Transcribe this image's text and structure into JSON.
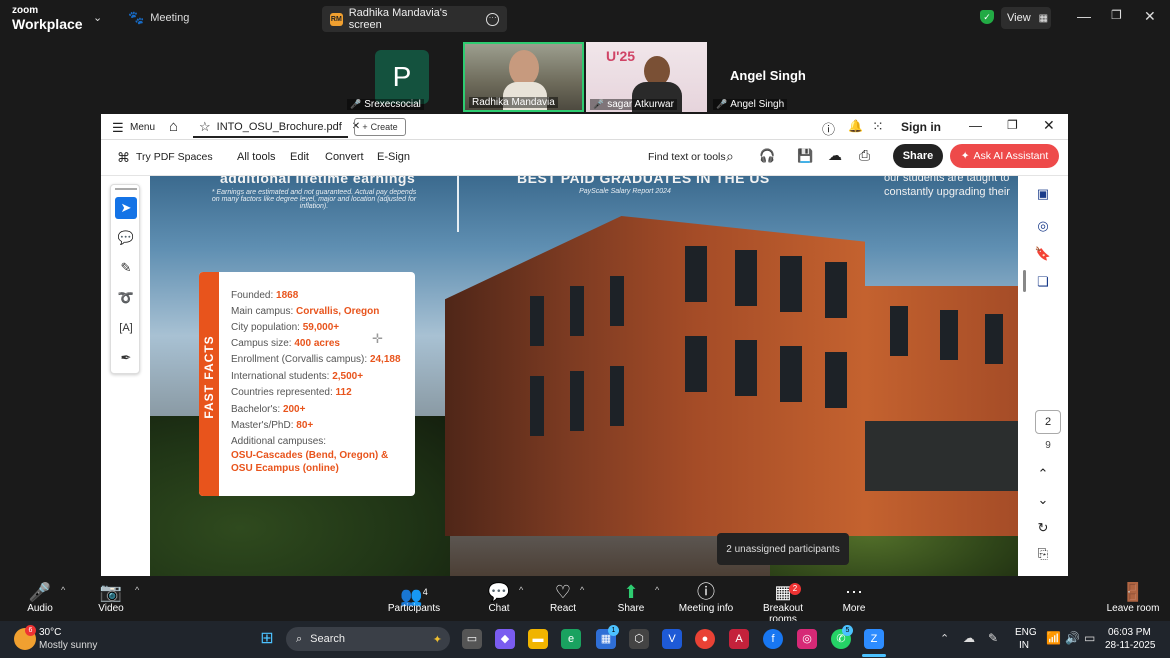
{
  "zoom_top": {
    "brand_line1": "zoom",
    "brand_line2": "Workplace",
    "meeting_label": "Meeting",
    "share_tab_badge": "RM",
    "share_tab_title": "Radhika Mandavia's screen",
    "view_label": "View"
  },
  "participants": [
    {
      "name": "Srexecsocial",
      "avatar_letter": "P",
      "muted": true
    },
    {
      "name": "Radhika Mandavia",
      "muted": false,
      "active": true
    },
    {
      "name": "sagar Atkurwar",
      "muted": true
    },
    {
      "name": "Angel Singh",
      "muted": true,
      "display_name": "Angel Singh"
    }
  ],
  "acrobat": {
    "menu_label": "Menu",
    "doc_tab": "INTO_OSU_Brochure.pdf",
    "create_label": "Create",
    "sign_in": "Sign in",
    "try_pdf_spaces": "Try PDF Spaces",
    "menus": [
      "All tools",
      "Edit",
      "Convert",
      "E-Sign"
    ],
    "find_label": "Find text or tools",
    "share_label": "Share",
    "ai_label": "Ask AI Assistant",
    "page_current": "2",
    "page_total": "9"
  },
  "document": {
    "heading_left": "additional lifetime earnings",
    "note_left": "* Earnings are estimated and not guaranteed. Actual pay depends on many factors like degree level, major and location (adjusted for inflation).",
    "heading_center": "BEST PAID GRADUATES IN THE US",
    "note_center": "PayScale Salary Report 2024",
    "heading_right_1": "our students are taught to",
    "heading_right_2": "constantly upgrading their",
    "facts_title": "FAST FACTS",
    "facts": [
      {
        "label": "Founded: ",
        "value": "1868"
      },
      {
        "label": "Main campus: ",
        "value": "Corvallis, Oregon"
      },
      {
        "label": "City population: ",
        "value": "59,000+"
      },
      {
        "label": "Campus size: ",
        "value": "400 acres"
      },
      {
        "label": "Enrollment (Corvallis campus): ",
        "value": "24,188"
      },
      {
        "label": "International students: ",
        "value": "2,500+"
      },
      {
        "label": "Countries represented: ",
        "value": "112"
      },
      {
        "label": "Bachelor's: ",
        "value": "200+"
      },
      {
        "label": "Master's/PhD: ",
        "value": "80+"
      },
      {
        "label": "Additional campuses:",
        "value": ""
      },
      {
        "label": "",
        "value": "OSU-Cascades (Bend, Oregon) &"
      },
      {
        "label": "",
        "value": "OSU Ecampus (online)"
      }
    ]
  },
  "tooltip": "2 unassigned participants",
  "zoom_bottom": {
    "audio": "Audio",
    "video": "Video",
    "participants": "Participants",
    "participants_count": "4",
    "chat": "Chat",
    "react": "React",
    "share": "Share",
    "meeting_info": "Meeting info",
    "breakout_rooms": "Breakout rooms",
    "breakout_badge": "2",
    "more": "More",
    "leave": "Leave room"
  },
  "taskbar": {
    "weather_temp": "30°C",
    "weather_desc": "Mostly sunny",
    "weather_badge": "6",
    "search": "Search",
    "lang_1": "ENG",
    "lang_2": "IN",
    "time": "06:03 PM",
    "date": "28-11-2025",
    "badge_store": "1",
    "badge_whatsapp": "5"
  },
  "colors": {
    "accent_orange": "#e8541c",
    "acrobat_red": "#ee4a4a",
    "active_green": "#2ecc71",
    "tool_blue": "#1473e6"
  }
}
